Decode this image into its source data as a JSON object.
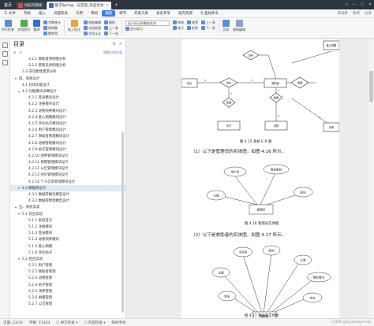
{
  "titlebar": {
    "home": "首页",
    "tabs": [
      {
        "label": "找稻壳模板",
        "icon_color": "#e04a3c",
        "active": false
      },
      {
        "label": "基于Spring…与实现_毕业论文",
        "icon_color": "#2f6fd8",
        "active": true
      }
    ],
    "add_tab": "+",
    "window_controls": [
      "▭",
      "—",
      "▢",
      "✕"
    ]
  },
  "menubar": {
    "items": [
      "三 文件",
      "开始",
      "插入",
      "页面布局",
      "引用",
      "审阅",
      "视图",
      "章节",
      "开发工具",
      "会员专享",
      "稻壳资源",
      "Q 查找命令"
    ],
    "active_index": 6,
    "right": [
      "未同步",
      "协作",
      "分享"
    ]
  },
  "ribbon": {
    "big_buttons": [
      {
        "label": "拼写检查",
        "icon": "spellcheck-icon",
        "color": "#5a8fd6"
      },
      {
        "label": "文档校对",
        "icon": "proofread-icon",
        "color": "#4caf50"
      },
      {
        "label": "翻译",
        "icon": "translate-icon",
        "color": "#2f6fd8"
      },
      {
        "label": "插入批注",
        "icon": "comment-icon",
        "color": "#e8a53a"
      }
    ],
    "col1": [
      "字数统计",
      "简转繁",
      "繁转简"
    ],
    "col2": [
      "限制编辑",
      "文档权限",
      "文档认证"
    ],
    "col3": [
      "删除",
      "上一条",
      "下一条"
    ],
    "markup_select": "显示标记的最终状态",
    "col4": [
      "显示标记",
      "审阅",
      "修订"
    ],
    "col5": [
      "接受",
      "拒绝",
      "上一条",
      "下一条"
    ],
    "right_buttons": [
      "比较",
      "限制编辑"
    ]
  },
  "outline": {
    "title": "目录",
    "tools": [
      "⊞",
      "⊟"
    ],
    "smart": "智能识别目录",
    "items": [
      {
        "text": "3.2.1 救助者用例图分析",
        "level": 3,
        "arrow": ""
      },
      {
        "text": "3.2.2 管理员用例图分析",
        "level": 3,
        "arrow": ""
      },
      {
        "text": "3.3 非功能性需求分析",
        "level": 2,
        "arrow": ""
      },
      {
        "text": "四、系统设计",
        "level": 1,
        "arrow": "▾"
      },
      {
        "text": "4.1 总体功能设计",
        "level": 2,
        "arrow": ""
      },
      {
        "text": "4.2 功能模块详细设计",
        "level": 2,
        "arrow": "▾"
      },
      {
        "text": "4.2.1 登录模块设计",
        "level": 3,
        "arrow": ""
      },
      {
        "text": "4.2.2 注册模块设计",
        "level": 3,
        "arrow": ""
      },
      {
        "text": "4.2.3 动物领养模块设计",
        "level": 3,
        "arrow": ""
      },
      {
        "text": "4.2.4 爱心捐赠模块设计",
        "level": 3,
        "arrow": ""
      },
      {
        "text": "4.2.5 评论帖子模块设计",
        "level": 3,
        "arrow": ""
      },
      {
        "text": "4.2.6 用户管理模块设计",
        "level": 3,
        "arrow": ""
      },
      {
        "text": "4.2.7 救助者管理模块设计",
        "level": 3,
        "arrow": ""
      },
      {
        "text": "4.2.8 动物管理模块设计",
        "level": 3,
        "arrow": ""
      },
      {
        "text": "4.2.9 帖子管理模块设计",
        "level": 3,
        "arrow": ""
      },
      {
        "text": "4.2.10 领养管理模块设计",
        "level": 3,
        "arrow": ""
      },
      {
        "text": "4.2.11 捐赠管理模块设计",
        "level": 3,
        "arrow": ""
      },
      {
        "text": "4.2.12 公告管理模块设计",
        "level": 3,
        "arrow": ""
      },
      {
        "text": "4.2.13 评论管理模块设计",
        "level": 3,
        "arrow": ""
      },
      {
        "text": "4.2.14 个人信息管理模块设计",
        "level": 3,
        "arrow": ""
      },
      {
        "text": "4.3 数据库设计",
        "level": 2,
        "arrow": "▾",
        "active": true
      },
      {
        "text": "4.3.1 数据库概念模型设计",
        "level": 3,
        "arrow": ""
      },
      {
        "text": "4.3.2 数据库物理模型设计",
        "level": 3,
        "arrow": ""
      },
      {
        "text": "五、系统实现",
        "level": 1,
        "arrow": "▾"
      },
      {
        "text": "5.1 前台实现",
        "level": 2,
        "arrow": "▾"
      },
      {
        "text": "5.1.1 系统首页",
        "level": 3,
        "arrow": ""
      },
      {
        "text": "5.1.2 注册模块",
        "level": 3,
        "arrow": ""
      },
      {
        "text": "5.1.3 登录模块",
        "level": 3,
        "arrow": ""
      },
      {
        "text": "5.1.4 动物领养模块",
        "level": 3,
        "arrow": ""
      },
      {
        "text": "5.1.5 爱心捐赠",
        "level": 3,
        "arrow": ""
      },
      {
        "text": "5.1.6 评论帖子",
        "level": 3,
        "arrow": ""
      },
      {
        "text": "5.2 后台实现",
        "level": 2,
        "arrow": "▾"
      },
      {
        "text": "5.2.1 用户管理",
        "level": 3,
        "arrow": ""
      },
      {
        "text": "5.2.2 救助者管理",
        "level": 3,
        "arrow": ""
      },
      {
        "text": "5.2.3 动物管理",
        "level": 3,
        "arrow": ""
      },
      {
        "text": "5.2.4 帖子管理",
        "level": 3,
        "arrow": ""
      },
      {
        "text": "5.2.5 领养管理",
        "level": 3,
        "arrow": ""
      },
      {
        "text": "5.2.6 捐赠管理",
        "level": 3,
        "arrow": ""
      },
      {
        "text": "5.2.7 公告管理",
        "level": 3,
        "arrow": ""
      }
    ]
  },
  "document": {
    "fig415_caption": "图 4.15 系统 E-R 图",
    "para1": "（1）以下是管理员的实体图，如图 4.16 所示。",
    "fig416_caption": "图 4.16 管理员实体图",
    "para2": "（2）以下是救助者的实体图，如图 4.17 所示。",
    "fig417_caption": "图 4.17 救助者实体图",
    "er": {
      "entities": [
        "评论",
        "救助者",
        "公告",
        "帖子",
        "动物",
        "领养",
        "爱心捐赠"
      ],
      "relations": [
        "发布",
        "管理",
        "管理",
        "管理",
        "发布"
      ],
      "cardinality": [
        "1",
        "n",
        "1",
        "1",
        "n",
        "n"
      ]
    },
    "admin_entity": {
      "name": "管理员",
      "attributes": [
        "用户名",
        "登录密码",
        "主键",
        "密码"
      ]
    },
    "rescuer_entity": {
      "name": "救助者",
      "attributes": [
        "手机号",
        "性别",
        "头像",
        "主键",
        "姓名",
        "住址",
        "救助者ID",
        "自救者ID"
      ]
    }
  },
  "statusbar": {
    "items": [
      "页面: 23/43",
      "字数: 11443",
      "☐ 拼写检查 ▾",
      "☐ 内容检查 ▾",
      "缺失字体"
    ],
    "watermark": "CSDN @biyezuopinvip"
  },
  "colors": {
    "accent": "#3e7ee6",
    "titlebar_bg": "#2c3440"
  }
}
